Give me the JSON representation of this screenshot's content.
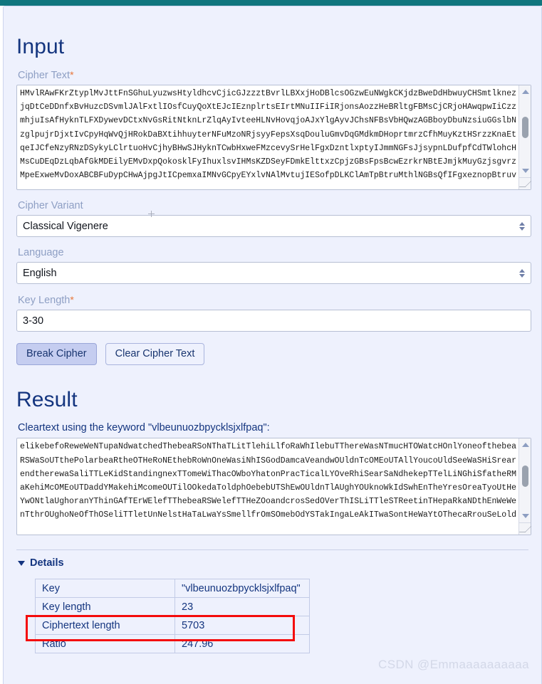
{
  "theme": {
    "topbar_color": "#10767e",
    "page_bg": "#eef1fd",
    "heading_color": "#14357f",
    "label_color": "#8e9fc4",
    "required_color": "#e8763a",
    "highlight_box_color": "#f40b0b",
    "primary_button_bg": "#c5cdf0"
  },
  "input": {
    "title": "Input",
    "cipher_text_label": "Cipher Text",
    "required_mark": "*",
    "cipher_text_value": "HMvlRAwFKrZtyplMvJttFnSGhuLyuzwsHtyldhcvCjicGJzzztBvrlLBXxjHoDBlcsOGzwEuNWgkCKjdzBweDdHbwuyCHSmtlknez\njqDtCeDDnfxBvHuzcDSvmlJAlFxtlIOsfCuyQoXtEJcIEznplrtsEIrtMNuIIFiIRjonsAozzHeBRltgFBMsCjCRjoHAwqpwIiCzz\nmhjuIsAfHyknTLFXDywevDCtxNvGsRitNtknLrZlqAyIvteeHLNvHovqjoAJxYlgAyvJChsNFBsVbHQwzAGBboyDbuNzsiuGGslbN\nzglpujrDjxtIvCpyHqWvQjHRokDaBXtihhuyterNFuMzoNRjsyyFepsXsqDouluGmvDqGMdkmDHoprtmrzCfhMuyKztHSrzzKnaEt\nqeIJCfeNzyRNzDSykyLClrtuoHvCjhyBHwSJHyknTCwbHxweFMzcevySrHelFgxDzntlxptyIJmmNGFsJjsypnLDufpfCdTWlohcH\nMsCuDEqDzLqbAfGkMDEilyEMvDxpQokosklFyIhuxlsvIHMsKZDSeyFDmkElttxzCpjzGBsFpsBcwEzrkrNBtEJmjkMuyGzjsgvrz\nMpeExweMvDoxABCBFuDypCHwAjpgJtICpemxaIMNvGCpyEYxlvNAlMvtujIESofpDLKClAmTpBtruMthlNGBsQfIFgxeznopBtruv",
    "cipher_variant_label": "Cipher Variant",
    "cipher_variant_value": "Classical Vigenere",
    "language_label": "Language",
    "language_value": "English",
    "key_length_label": "Key Length",
    "key_length_required": "*",
    "key_length_value": "3-30",
    "break_button": "Break Cipher",
    "clear_button": "Clear Cipher Text"
  },
  "result": {
    "title": "Result",
    "caption": "Cleartext using the keyword \"vlbeunuozbpycklsjxlfpaq\":",
    "cleartext_value": "elikebefoReweWeNTupaNdwatchedThebeaRSoNThaTLitTlehiLlfoRaWhIlebuTThereWasNTmucHTOWatcHOnlYoneofthebea\nRSWaSoUTthePolarbeaRtheOTHeRoNEthebRoWnOneWasiNhISGodDamcaVeandwOUldnTcOMEoUTAllYoucoUldSeeWaSHiSrear\nendtherewaSaliTTLeKidStandingnexTTomeWiThacOWboYhatonPracTicalLYOveRhiSearSaNdhekepTTelLiNGhiSfatheRM\naKehiMcOMEoUTDaddYMakehiMcomeOUTilOOkedaToldphOebebUTShEwOUldnTlAUghYOUknoWkIdSwhEnTheYresOreaTyoUtHe\nYwONtlaUghoranYThinGAfTErWElefTThebeaRSWelefTTHeZOoandcrosSedOVerThISLiTTleSTReetinTHepaRkaNDthEnWeWe\nnTthrOUghoNeOfThOSeliTTletUnNelstHaTaLwaYsSmellfrOmSOmebOdYSTakIngaLeAkITwaSontHeWaYtOThecaRrouSeLold",
    "details_label": "Details",
    "details_rows": [
      {
        "key": "Key",
        "value": "\"vlbeunuozbpycklsjxlfpaq\""
      },
      {
        "key": "Key length",
        "value": "23"
      },
      {
        "key": "Ciphertext length",
        "value": "5703"
      },
      {
        "key": "Ratio",
        "value": "247.96"
      }
    ]
  },
  "watermark": {
    "text": "CSDN @Emmaaaaaaaaaa"
  }
}
